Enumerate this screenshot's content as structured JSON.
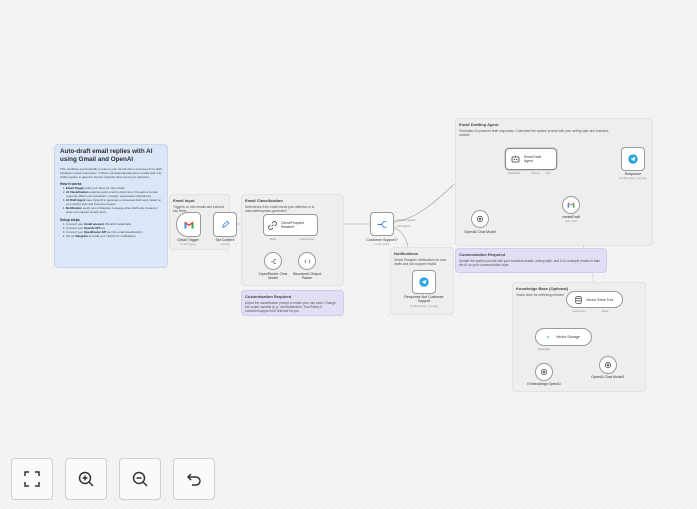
{
  "intro": {
    "title": "Auto-draft email replies with AI using Gmail and OpenAI",
    "description": "This workflow automatically monitors your Gmail inbox and uses AI to draft intelligent email responses. It filters out automated/system emails and only drafts replies to genuine human inquiries that need your attention.",
    "how_title": "How it works",
    "how_steps": [
      {
        "bold": "Email Trigger",
        "text": " polls your inbox for new emails"
      },
      {
        "bold": "AI Classification",
        "text": " analyzes each email to determine if it needs a human response (filters out newsletters, receipts, automated notifications)"
      },
      {
        "bold": "AI Draft Agent",
        "text": " uses OpenAI to generate a contextual draft reply based on your writing style and business context"
      },
      {
        "bold": "Notification",
        "text": " sends you a Telegram message when drafts are created or when non-support emails arrive"
      }
    ],
    "setup_title": "Setup steps",
    "setup_steps": [
      {
        "pre": "Connect your ",
        "bold": "Gmail account",
        "post": " (OAuth2 credentials)"
      },
      {
        "pre": "Connect your ",
        "bold": "OpenAI API",
        "post": " key"
      },
      {
        "pre": "Connect your ",
        "bold": "OpenRouter API",
        "post": " key (for email classification)"
      },
      {
        "pre": "Set up ",
        "bold": "Telegram",
        "post": " and add your chat ID for notifications"
      }
    ]
  },
  "stickies": {
    "email_input": {
      "title": "Email Input",
      "desc": "Triggers on new emails and extracts key fields"
    },
    "classification": {
      "title": "Email Classification",
      "desc": "Determines if the email needs your attention or is automated/system-generated"
    },
    "drafting": {
      "title": "Email Drafting Agent",
      "desc": "Generates AI-powered draft responses. Customise the system prompt with your writing style and business context."
    },
    "notifications": {
      "title": "Notifications",
      "desc": "Sends Telegram notifications for new drafts and non-support emails"
    },
    "custom1": {
      "title": "Customisation Required",
      "desc": "Adjust the classification prompt to match your use case. Change the output variable (e.g., needsAttention: True/False) if customer/support isn't relevant for you."
    },
    "custom2": {
      "title": "Customisation Required",
      "desc": "Update the system prompt with your business details, writing style, and 5-10 example emails to train the AI on your communication style."
    },
    "kb": {
      "title": "Knowledge Base (Optional)",
      "desc": "Vector store for retrieving relevant"
    }
  },
  "nodes": {
    "gmail_trigger": {
      "label": "Gmail Trigger",
      "sub": "Gmail Trigger",
      "icon": "gmail-icon"
    },
    "set_content": {
      "label": "Set Content",
      "sub": "manual",
      "icon": "pencil-icon"
    },
    "classifier": {
      "label": "Client/Prospect Related?",
      "icon": "link-icon"
    },
    "openrouter": {
      "label": "OpenRouter Chat Model",
      "icon": "openrouter-icon"
    },
    "parser": {
      "label": "Structured Output Parser",
      "icon": "code-icon"
    },
    "customer_support": {
      "label": "Customer Support?",
      "sub": "mode: Rules",
      "icon": "switch-icon"
    },
    "agent": {
      "label": "Email Draft Agent",
      "icon": "robot-icon"
    },
    "openai_chat": {
      "label": "OpenAI Chat Model",
      "icon": "openai-icon"
    },
    "create_draft": {
      "label": "createDraft",
      "sub": "draft: draft",
      "icon": "gmail-icon"
    },
    "response": {
      "label": "Response",
      "sub": "sendMessage: message",
      "icon": "telegram-icon"
    },
    "not_support": {
      "label": "Response Not Customer Support",
      "sub": "sendMessage: message",
      "icon": "telegram-icon"
    },
    "vector_tool": {
      "label": "Vector Store Tool",
      "icon": "database-icon"
    },
    "vector_storage": {
      "label": "Vector Storage",
      "icon": "vector-icon"
    },
    "embeddings": {
      "label": "Embeddings OpenAI",
      "icon": "openai-icon"
    },
    "openai_chat2": {
      "label": "OpenAI Chat Model1",
      "icon": "openai-icon"
    }
  },
  "connection_labels": {
    "model": "Model",
    "output_parser": "Output Parser",
    "customer_support_out": "Customer Support",
    "not_support_out": "Not Support",
    "chat_model": "Chat Model",
    "memory": "Memory",
    "tool": "Tool",
    "vector_store": "Vector Store",
    "embedding": "Embedding"
  },
  "controls": {
    "fit": "fit-view-icon",
    "zoom_in": "zoom-in-icon",
    "zoom_out": "zoom-out-icon",
    "undo": "undo-icon"
  },
  "colors": {
    "gmail_red": "#ea4335",
    "telegram_blue": "#27a3e0",
    "openai_black": "#333333",
    "vector_green": "#31c48d",
    "edge_grey": "#9b9b9b",
    "link_blue": "#5aa0e0"
  }
}
